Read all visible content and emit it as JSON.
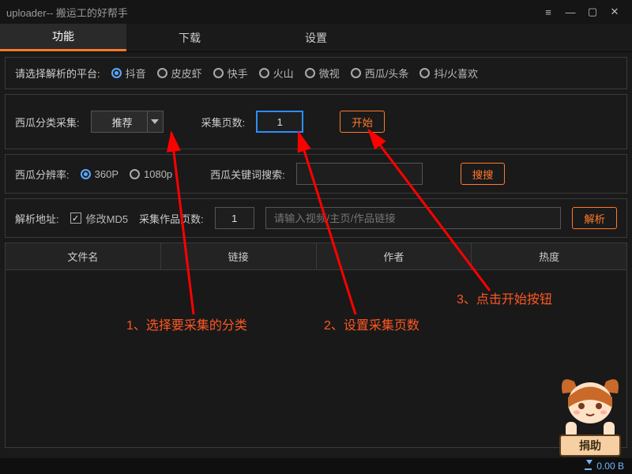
{
  "window": {
    "title": "uploader-- 搬运工的好帮手"
  },
  "tabs": {
    "t0": "功能",
    "t1": "下载",
    "t2": "设置"
  },
  "platform": {
    "label": "请选择解析的平台:",
    "options": {
      "o0": "抖音",
      "o1": "皮皮虾",
      "o2": "快手",
      "o3": "火山",
      "o4": "微视",
      "o5": "西瓜/头条",
      "o6": "抖/火喜欢"
    }
  },
  "collect": {
    "label": "西瓜分类采集:",
    "select_value": "推荐",
    "pages_label": "采集页数:",
    "pages_value": "1",
    "start_btn": "开始"
  },
  "resolution": {
    "label": "西瓜分辨率:",
    "options": {
      "r0": "360P",
      "r1": "1080p"
    },
    "keyword_label": "西瓜关键词搜索:",
    "search_btn": "搜搜"
  },
  "parse": {
    "label": "解析地址:",
    "md5_label": "修改MD5",
    "work_pages_label": "采集作品页数:",
    "work_pages_value": "1",
    "url_placeholder": "请输入视频/主页/作品链接",
    "parse_btn": "解析"
  },
  "table": {
    "headers": {
      "h0": "文件名",
      "h1": "链接",
      "h2": "作者",
      "h3": "热度"
    }
  },
  "annotations": {
    "a1": "1、选择要采集的分类",
    "a2": "2、设置采集页数",
    "a3": "3、点击开始按钮"
  },
  "mascot": {
    "donate": "捐助"
  },
  "status": {
    "speed": "0.00 B"
  }
}
